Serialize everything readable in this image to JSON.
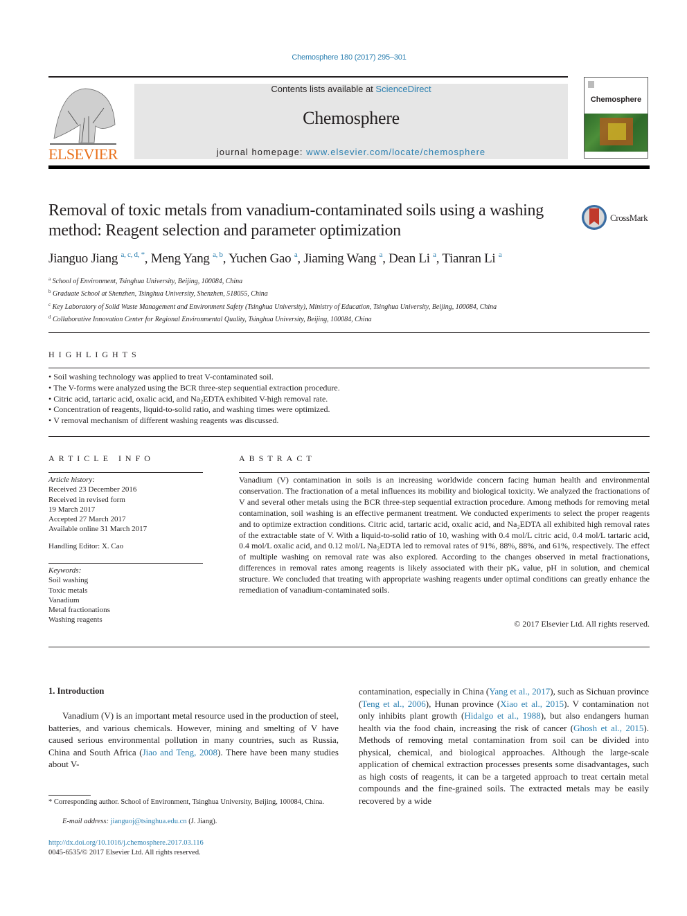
{
  "header": {
    "citation": "Chemosphere 180 (2017) 295–301",
    "contents_prefix": "Contents lists available at ",
    "contents_link": "ScienceDirect",
    "journal_name": "Chemosphere",
    "homepage_prefix": "journal homepage: ",
    "homepage_link": "www.elsevier.com/locate/chemosphere",
    "publisher_logo_text": "ELSEVIER",
    "cover_title": "Chemosphere",
    "brand_color": "#e9711c",
    "link_color": "#2a7fb0"
  },
  "article": {
    "title": "Removal of toxic metals from vanadium-contaminated soils using a washing method: Reagent selection and parameter optimization",
    "crossmark_label": "CrossMark",
    "authors": [
      {
        "name": "Jianguo Jiang",
        "sup": "a, c, d, *"
      },
      {
        "name": "Meng Yang",
        "sup": "a, b"
      },
      {
        "name": "Yuchen Gao",
        "sup": "a"
      },
      {
        "name": "Jiaming Wang",
        "sup": "a"
      },
      {
        "name": "Dean Li",
        "sup": "a"
      },
      {
        "name": "Tianran Li",
        "sup": "a"
      }
    ],
    "affiliations": [
      {
        "key": "a",
        "text": "School of Environment, Tsinghua University, Beijing, 100084, China"
      },
      {
        "key": "b",
        "text": "Graduate School at Shenzhen, Tsinghua University, Shenzhen, 518055, China"
      },
      {
        "key": "c",
        "text": "Key Laboratory of Solid Waste Management and Environment Safety (Tsinghua University), Ministry of Education, Tsinghua University, Beijing, 100084, China"
      },
      {
        "key": "d",
        "text": "Collaborative Innovation Center for Regional Environmental Quality, Tsinghua University, Beijing, 100084, China"
      }
    ]
  },
  "highlights": {
    "heading": "HIGHLIGHTS",
    "items": [
      "Soil washing technology was applied to treat V-contaminated soil.",
      "The V-forms were analyzed using the BCR three-step sequential extraction procedure.",
      "Citric acid, tartaric acid, oxalic acid, and Na₂EDTA exhibited V-high removal rate.",
      "Concentration of reagents, liquid-to-solid ratio, and washing times were optimized.",
      "V removal mechanism of different washing reagents was discussed."
    ]
  },
  "article_info": {
    "heading": "ARTICLE INFO",
    "history_label": "Article history:",
    "history": [
      "Received 23 December 2016",
      "Received in revised form",
      "19 March 2017",
      "Accepted 27 March 2017",
      "Available online 31 March 2017"
    ],
    "handling_editor": "Handling Editor: X. Cao",
    "keywords_label": "Keywords:",
    "keywords": [
      "Soil washing",
      "Toxic metals",
      "Vanadium",
      "Metal fractionations",
      "Washing reagents"
    ]
  },
  "abstract": {
    "heading": "ABSTRACT",
    "text": "Vanadium (V) contamination in soils is an increasing worldwide concern facing human health and environmental conservation. The fractionation of a metal influences its mobility and biological toxicity. We analyzed the fractionations of V and several other metals using the BCR three-step sequential extraction procedure. Among methods for removing metal contamination, soil washing is an effective permanent treatment. We conducted experiments to select the proper reagents and to optimize extraction conditions. Citric acid, tartaric acid, oxalic acid, and Na₂EDTA all exhibited high removal rates of the extractable state of V. With a liquid-to-solid ratio of 10, washing with 0.4 mol/L citric acid, 0.4 mol/L tartaric acid, 0.4 mol/L oxalic acid, and 0.12 mol/L Na₂EDTA led to removal rates of 91%, 88%, 88%, and 61%, respectively. The effect of multiple washing on removal rate was also explored. According to the changes observed in metal fractionations, differences in removal rates among reagents is likely associated with their pKₐ value, pH in solution, and chemical structure. We concluded that treating with appropriate washing reagents under optimal conditions can greatly enhance the remediation of vanadium-contaminated soils.",
    "copyright": "© 2017 Elsevier Ltd. All rights reserved."
  },
  "body": {
    "section_heading": "1.  Introduction",
    "left_col": [
      {
        "t": "Vanadium (V) is an important metal resource used in the production of steel, batteries, and various chemicals. However, mining and smelting of V have caused serious environmental pollution in many countries, such as Russia, China and South Africa ("
      },
      {
        "link": "Jiao and Teng, 2008"
      },
      {
        "t": "). There have been many studies about V-"
      }
    ],
    "right_col": [
      {
        "t": "contamination, especially in China ("
      },
      {
        "link": "Yang et al., 2017"
      },
      {
        "t": "), such as Sichuan province ("
      },
      {
        "link": "Teng et al., 2006"
      },
      {
        "t": "), Hunan province ("
      },
      {
        "link": "Xiao et al., 2015"
      },
      {
        "t": "). V contamination not only inhibits plant growth ("
      },
      {
        "link": "Hidalgo et al., 1988"
      },
      {
        "t": "), but also endangers human health via the food chain, increasing the risk of cancer ("
      },
      {
        "link": "Ghosh et al., 2015"
      },
      {
        "t": "). Methods of removing metal contamination from soil can be divided into physical, chemical, and biological approaches. Although the large-scale application of chemical extraction processes presents some disadvantages, such as high costs of reagents, it can be a targeted approach to treat certain metal compounds and the fine-grained soils. The extracted metals may be easily recovered by a wide"
      }
    ]
  },
  "footer": {
    "footnote": "* Corresponding author. School of Environment, Tsinghua University, Beijing, 100084, China.",
    "email_label": "E-mail address: ",
    "email": "jianguoj@tsinghua.edu.cn",
    "email_suffix": " (J. Jiang).",
    "doi": "http://dx.doi.org/10.1016/j.chemosphere.2017.03.116",
    "issn": "0045-6535/© 2017 Elsevier Ltd. All rights reserved."
  }
}
